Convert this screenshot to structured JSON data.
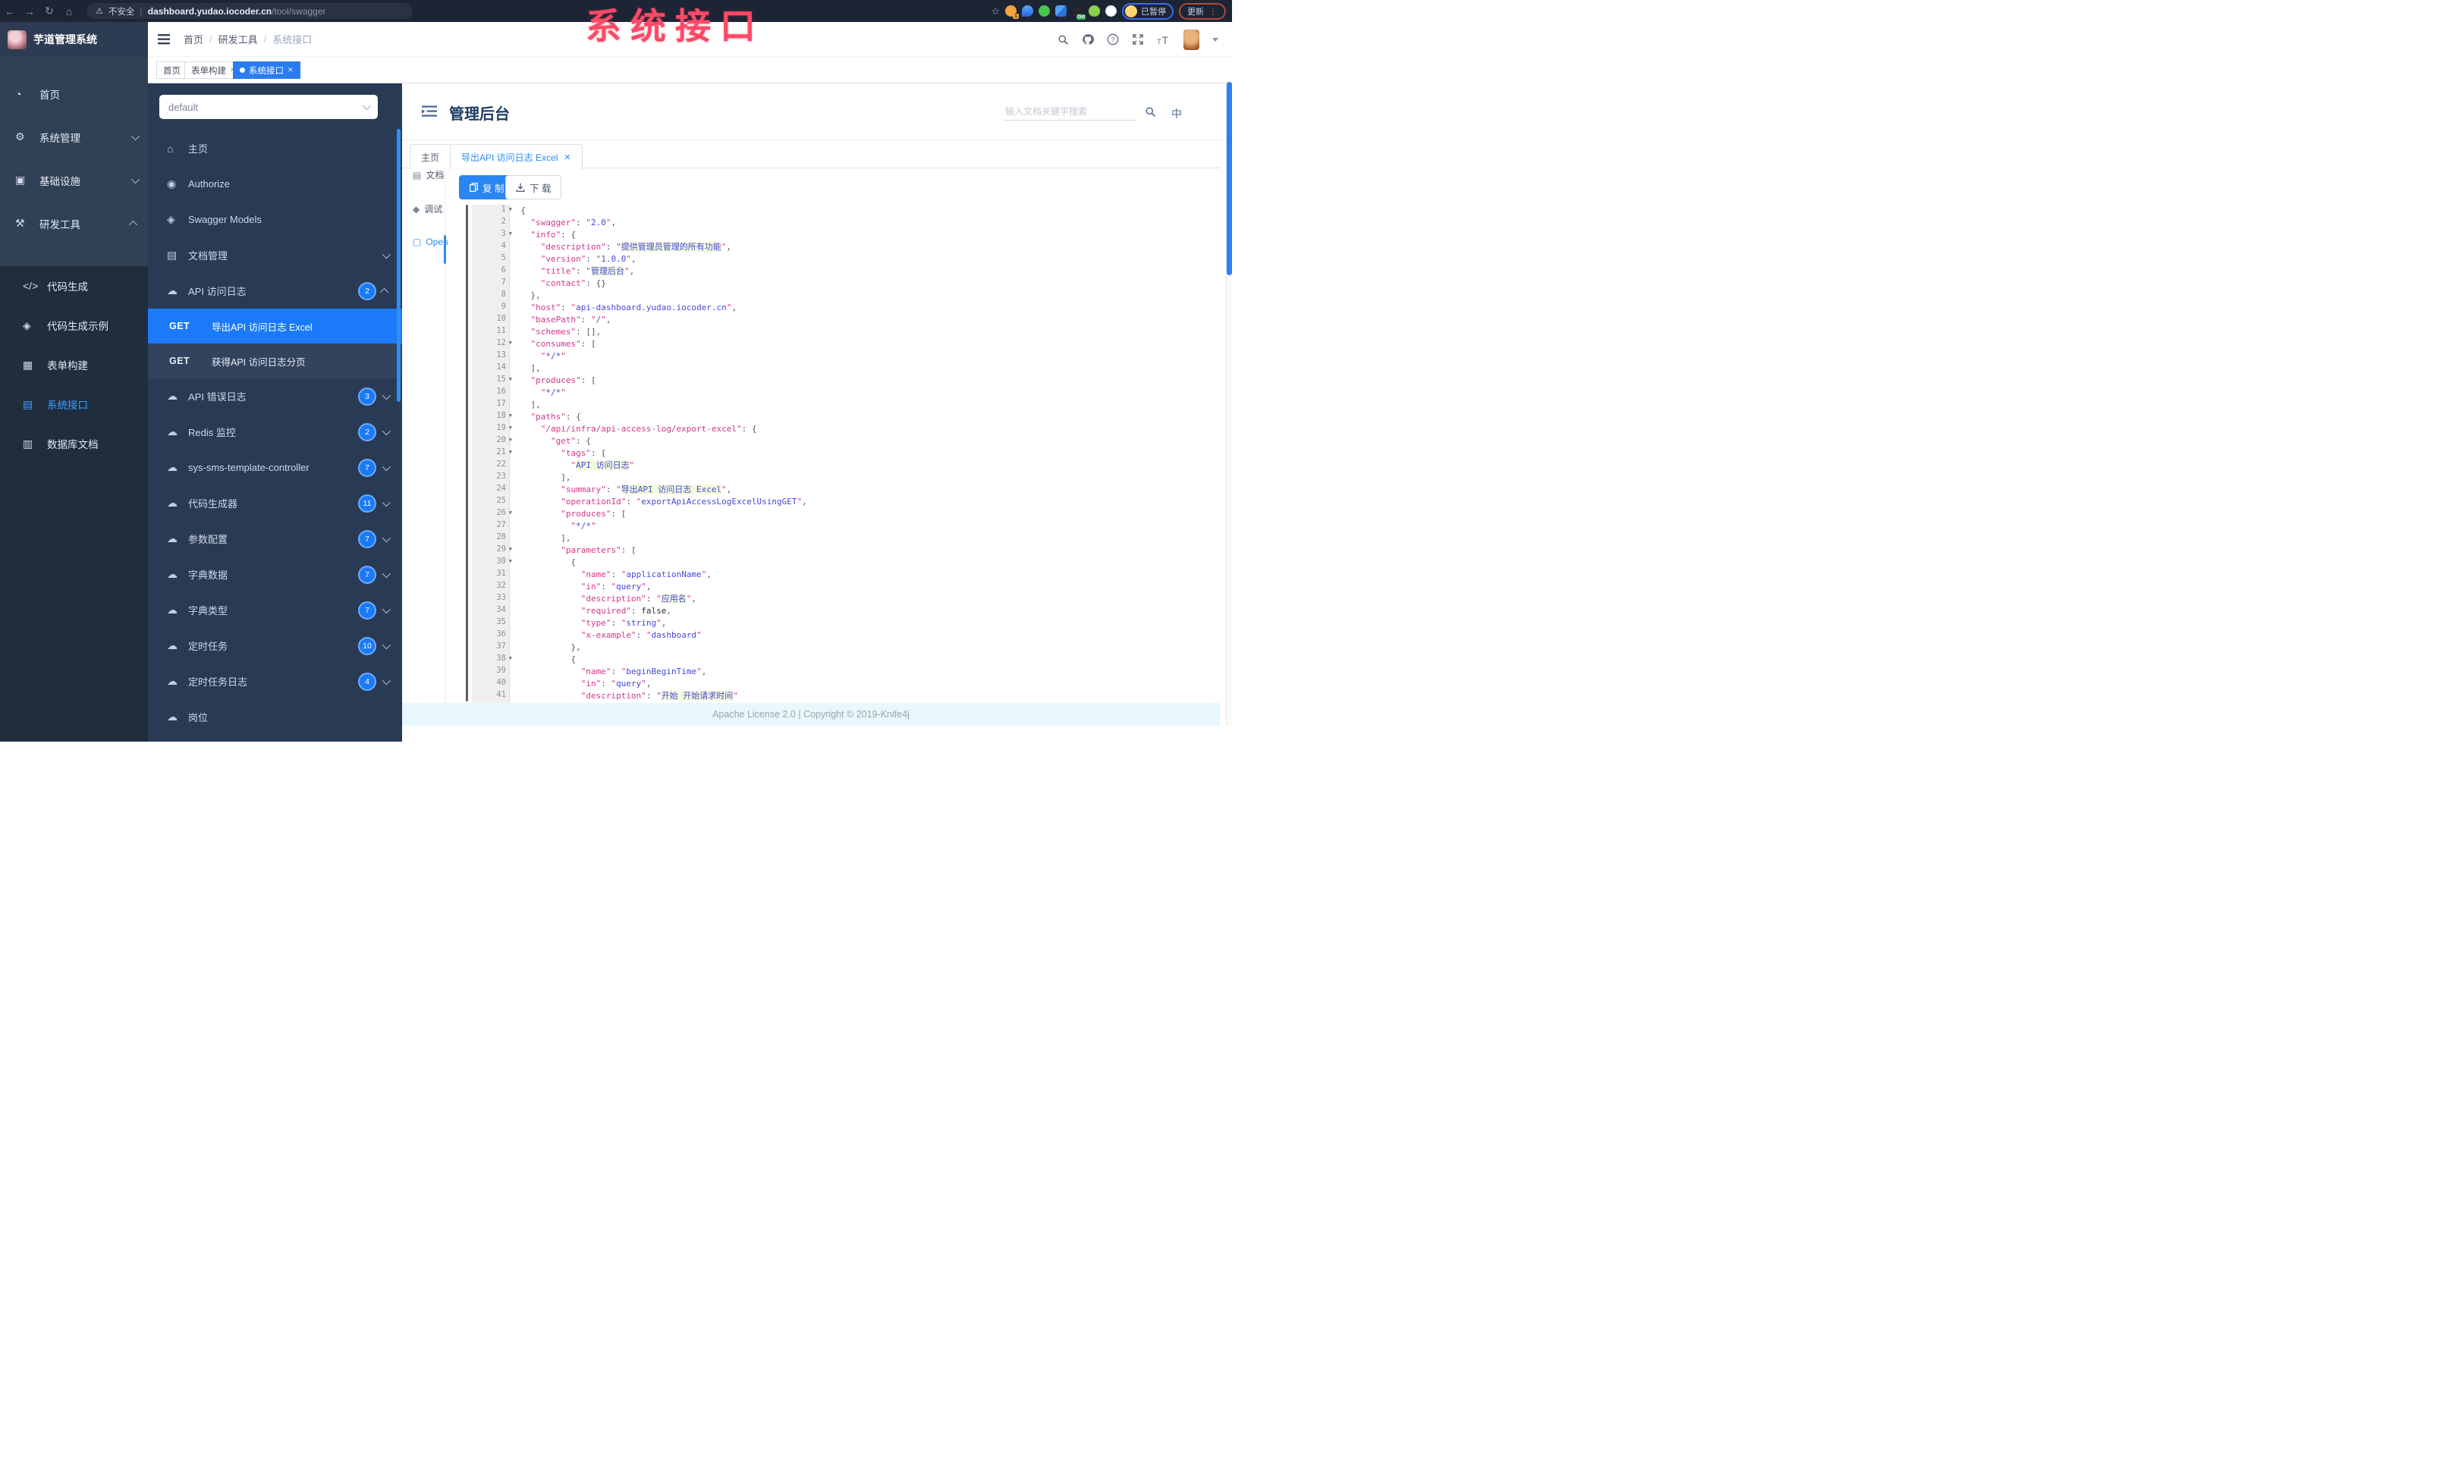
{
  "watermark": "系统接口",
  "browser": {
    "security_label": "不安全",
    "url_host": "dashboard.yudao.iocoder.cn",
    "url_path": "/tool/swagger",
    "ext_badge": "1",
    "ext_gn": "Gn",
    "paused_label": "已暂停",
    "update_label": "更新"
  },
  "app": {
    "title": "芋道管理系统",
    "breadcrumb": [
      "首页",
      "研发工具",
      "系统接口"
    ],
    "tags": [
      {
        "label": "首页",
        "closable": false,
        "active": false
      },
      {
        "label": "表单构建",
        "closable": true,
        "active": false
      },
      {
        "label": "系统接口",
        "closable": true,
        "active": true
      }
    ],
    "sidebar_top": [
      {
        "icon": "dashboard-icon",
        "glyph": "◔",
        "label": "首页",
        "chevron": ""
      },
      {
        "icon": "gear-icon",
        "glyph": "⚙",
        "label": "系统管理",
        "chevron": "down"
      },
      {
        "icon": "infra-icon",
        "glyph": "▣",
        "label": "基础设施",
        "chevron": "down"
      },
      {
        "icon": "tools-icon",
        "glyph": "⚒",
        "label": "研发工具",
        "chevron": "up"
      }
    ],
    "sidebar_sub": [
      {
        "icon": "code-icon",
        "glyph": "</>",
        "label": "代码生成",
        "active": false
      },
      {
        "icon": "shield-icon",
        "glyph": "◈",
        "label": "代码生成示例",
        "active": false
      },
      {
        "icon": "form-icon",
        "glyph": "▦",
        "label": "表单构建",
        "active": false
      },
      {
        "icon": "api-icon",
        "glyph": "▤",
        "label": "系统接口",
        "active": true
      },
      {
        "icon": "database-icon",
        "glyph": "▥",
        "label": "数据库文档",
        "active": false
      }
    ]
  },
  "k": {
    "group_select": "default",
    "menu": [
      {
        "icon": "home-icon",
        "glyph": "⌂",
        "label": "主页"
      },
      {
        "icon": "lock-icon",
        "glyph": "◉",
        "label": "Authorize"
      },
      {
        "icon": "cube-icon",
        "glyph": "◈",
        "label": "Swagger Models"
      },
      {
        "icon": "doc-icon",
        "glyph": "▤",
        "label": "文档管理",
        "chevron": "down"
      },
      {
        "icon": "cloud-icon",
        "glyph": "☁",
        "label": "API 访问日志",
        "badge": "2",
        "chevron": "up",
        "children": [
          {
            "method": "GET",
            "label": "导出API 访问日志 Excel",
            "active": true
          },
          {
            "method": "GET",
            "label": "获得API 访问日志分页",
            "active": false
          }
        ]
      },
      {
        "icon": "cloud-icon",
        "glyph": "☁",
        "label": "API 错误日志",
        "badge": "3",
        "chevron": "down"
      },
      {
        "icon": "cloud-icon",
        "glyph": "☁",
        "label": "Redis 监控",
        "badge": "2",
        "chevron": "down"
      },
      {
        "icon": "cloud-icon",
        "glyph": "☁",
        "label": "sys-sms-template-controller",
        "badge": "7",
        "chevron": "down"
      },
      {
        "icon": "cloud-icon",
        "glyph": "☁",
        "label": "代码生成器",
        "badge": "11",
        "chevron": "down"
      },
      {
        "icon": "cloud-icon",
        "glyph": "☁",
        "label": "参数配置",
        "badge": "7",
        "chevron": "down"
      },
      {
        "icon": "cloud-icon",
        "glyph": "☁",
        "label": "字典数据",
        "badge": "7",
        "chevron": "down"
      },
      {
        "icon": "cloud-icon",
        "glyph": "☁",
        "label": "字典类型",
        "badge": "7",
        "chevron": "down"
      },
      {
        "icon": "cloud-icon",
        "glyph": "☁",
        "label": "定时任务",
        "badge": "10",
        "chevron": "down"
      },
      {
        "icon": "cloud-icon",
        "glyph": "☁",
        "label": "定时任务日志",
        "badge": "4",
        "chevron": "down"
      },
      {
        "icon": "cloud-icon",
        "glyph": "☁",
        "label": "岗位",
        "badge": "",
        "chevron": ""
      }
    ],
    "main_title": "管理后台",
    "search_placeholder": "输入文档关键字搜索",
    "lang_label": "中",
    "doc_tabs": [
      {
        "label": "主页",
        "closable": false,
        "active": false
      },
      {
        "label": "导出API 访问日志 Excel",
        "closable": true,
        "active": true
      }
    ],
    "mini_side": [
      {
        "icon": "document-icon",
        "glyph": "▤",
        "label": "文档",
        "active": false
      },
      {
        "icon": "debug-icon",
        "glyph": "◆",
        "label": "调试",
        "active": false
      },
      {
        "icon": "open-file-icon",
        "glyph": "▢",
        "label": "Open",
        "active": true
      }
    ],
    "toolbar": {
      "copy": "复 制",
      "download": "下 载"
    },
    "footer": "Apache License 2.0 | Copyright © 2019-Knife4j",
    "code": {
      "lines": [
        {
          "i": 0,
          "f": true,
          "t": [
            [
              "p",
              "{"
            ]
          ]
        },
        {
          "i": 1,
          "t": [
            [
              "k",
              "swagger"
            ],
            [
              "p",
              ": "
            ],
            [
              "s",
              "2.0"
            ],
            [
              "p",
              ","
            ]
          ]
        },
        {
          "i": 1,
          "f": true,
          "t": [
            [
              "k",
              "info"
            ],
            [
              "p",
              ": "
            ],
            [
              "p",
              "{"
            ]
          ]
        },
        {
          "i": 2,
          "t": [
            [
              "k",
              "description"
            ],
            [
              "p",
              ": "
            ],
            [
              "h",
              "提供管理员管理的所有功能"
            ],
            [
              "p",
              ","
            ]
          ]
        },
        {
          "i": 2,
          "t": [
            [
              "k",
              "version"
            ],
            [
              "p",
              ": "
            ],
            [
              "s",
              "1.0.0"
            ],
            [
              "p",
              ","
            ]
          ]
        },
        {
          "i": 2,
          "t": [
            [
              "k",
              "title"
            ],
            [
              "p",
              ": "
            ],
            [
              "h",
              "管理后台"
            ],
            [
              "p",
              ","
            ]
          ]
        },
        {
          "i": 2,
          "t": [
            [
              "k",
              "contact"
            ],
            [
              "p",
              ": "
            ],
            [
              "p",
              "{}"
            ]
          ]
        },
        {
          "i": 1,
          "t": [
            [
              "p",
              "},"
            ]
          ]
        },
        {
          "i": 1,
          "t": [
            [
              "k",
              "host"
            ],
            [
              "p",
              ": "
            ],
            [
              "s",
              "api-dashboard.yudao.iocoder.cn"
            ],
            [
              "p",
              ","
            ]
          ]
        },
        {
          "i": 1,
          "t": [
            [
              "k",
              "basePath"
            ],
            [
              "p",
              ": "
            ],
            [
              "s",
              "/"
            ],
            [
              "p",
              ","
            ]
          ]
        },
        {
          "i": 1,
          "t": [
            [
              "k",
              "schemes"
            ],
            [
              "p",
              ": "
            ],
            [
              "p",
              "[],"
            ]
          ]
        },
        {
          "i": 1,
          "f": true,
          "t": [
            [
              "k",
              "consumes"
            ],
            [
              "p",
              ": "
            ],
            [
              "p",
              "["
            ]
          ]
        },
        {
          "i": 2,
          "t": [
            [
              "s",
              "*/*"
            ]
          ]
        },
        {
          "i": 1,
          "t": [
            [
              "p",
              "],"
            ]
          ]
        },
        {
          "i": 1,
          "f": true,
          "t": [
            [
              "k",
              "produces"
            ],
            [
              "p",
              ": "
            ],
            [
              "p",
              "["
            ]
          ]
        },
        {
          "i": 2,
          "t": [
            [
              "s",
              "*/*"
            ]
          ]
        },
        {
          "i": 1,
          "t": [
            [
              "p",
              "],"
            ]
          ]
        },
        {
          "i": 1,
          "f": true,
          "t": [
            [
              "k",
              "paths"
            ],
            [
              "p",
              ": "
            ],
            [
              "p",
              "{"
            ]
          ]
        },
        {
          "i": 2,
          "f": true,
          "t": [
            [
              "k",
              "/api/infra/api-access-log/export-excel"
            ],
            [
              "p",
              ": "
            ],
            [
              "p",
              "{"
            ]
          ]
        },
        {
          "i": 3,
          "f": true,
          "t": [
            [
              "k",
              "get"
            ],
            [
              "p",
              ": "
            ],
            [
              "p",
              "{"
            ]
          ]
        },
        {
          "i": 4,
          "f": true,
          "t": [
            [
              "k",
              "tags"
            ],
            [
              "p",
              ": "
            ],
            [
              "p",
              "["
            ]
          ]
        },
        {
          "i": 5,
          "t": [
            [
              "h",
              "API 访问日志"
            ]
          ]
        },
        {
          "i": 4,
          "t": [
            [
              "p",
              "],"
            ]
          ]
        },
        {
          "i": 4,
          "t": [
            [
              "k",
              "summary"
            ],
            [
              "p",
              ": "
            ],
            [
              "h",
              "导出API 访问日志 Excel"
            ],
            [
              "p",
              ","
            ]
          ]
        },
        {
          "i": 4,
          "t": [
            [
              "k",
              "operationId"
            ],
            [
              "p",
              ": "
            ],
            [
              "s",
              "exportApiAccessLogExcelUsingGET"
            ],
            [
              "p",
              ","
            ]
          ]
        },
        {
          "i": 4,
          "f": true,
          "t": [
            [
              "k",
              "produces"
            ],
            [
              "p",
              ": "
            ],
            [
              "p",
              "["
            ]
          ]
        },
        {
          "i": 5,
          "t": [
            [
              "s",
              "*/*"
            ]
          ]
        },
        {
          "i": 4,
          "t": [
            [
              "p",
              "],"
            ]
          ]
        },
        {
          "i": 4,
          "f": true,
          "t": [
            [
              "k",
              "parameters"
            ],
            [
              "p",
              ": "
            ],
            [
              "p",
              "["
            ]
          ]
        },
        {
          "i": 5,
          "f": true,
          "t": [
            [
              "p",
              "{"
            ]
          ]
        },
        {
          "i": 6,
          "t": [
            [
              "k",
              "name"
            ],
            [
              "p",
              ": "
            ],
            [
              "s",
              "applicationName"
            ],
            [
              "p",
              ","
            ]
          ]
        },
        {
          "i": 6,
          "t": [
            [
              "k",
              "in"
            ],
            [
              "p",
              ": "
            ],
            [
              "s",
              "query"
            ],
            [
              "p",
              ","
            ]
          ]
        },
        {
          "i": 6,
          "t": [
            [
              "k",
              "description"
            ],
            [
              "p",
              ": "
            ],
            [
              "h",
              "应用名"
            ],
            [
              "p",
              ","
            ]
          ]
        },
        {
          "i": 6,
          "t": [
            [
              "k",
              "required"
            ],
            [
              "p",
              ": "
            ],
            [
              "b",
              "false"
            ],
            [
              "p",
              ","
            ]
          ]
        },
        {
          "i": 6,
          "t": [
            [
              "k",
              "type"
            ],
            [
              "p",
              ": "
            ],
            [
              "s",
              "string"
            ],
            [
              "p",
              ","
            ]
          ]
        },
        {
          "i": 6,
          "t": [
            [
              "k",
              "x-example"
            ],
            [
              "p",
              ": "
            ],
            [
              "s",
              "dashboard"
            ]
          ]
        },
        {
          "i": 5,
          "t": [
            [
              "p",
              "},"
            ]
          ]
        },
        {
          "i": 5,
          "f": true,
          "t": [
            [
              "p",
              "{"
            ]
          ]
        },
        {
          "i": 6,
          "t": [
            [
              "k",
              "name"
            ],
            [
              "p",
              ": "
            ],
            [
              "s",
              "beginBeginTime"
            ],
            [
              "p",
              ","
            ]
          ]
        },
        {
          "i": 6,
          "t": [
            [
              "k",
              "in"
            ],
            [
              "p",
              ": "
            ],
            [
              "s",
              "query"
            ],
            [
              "p",
              ","
            ]
          ]
        },
        {
          "i": 6,
          "t": [
            [
              "k",
              "description"
            ],
            [
              "p",
              ": "
            ],
            [
              "h",
              "开始 开始请求时间"
            ]
          ]
        }
      ]
    },
    "colors": {
      "accent_blue": "#2b85f2",
      "selected_row": "#1a7af8",
      "sidebar_bg": "#293a54",
      "key_pink": "#d6358b",
      "value_blue": "#4748d8"
    }
  }
}
